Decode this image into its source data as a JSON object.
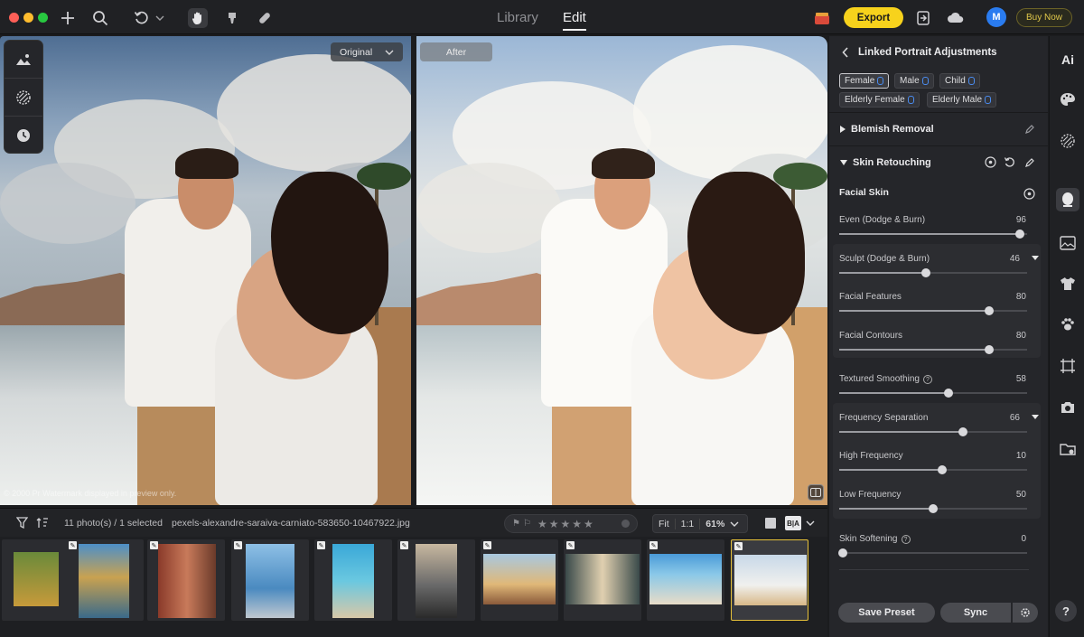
{
  "titlebar": {
    "tabs": [
      {
        "label": "Library",
        "active": false
      },
      {
        "label": "Edit",
        "active": true
      }
    ],
    "export_label": "Export",
    "avatar_initial": "M",
    "buy_label": "Buy Now"
  },
  "canvas": {
    "original_label": "Original",
    "after_label": "After",
    "watermark": "© 2000 Pr Watermark displayed in preview only."
  },
  "filmbar": {
    "count": "11 photo(s) / 1 selected",
    "filename": "pexels-alexandre-saraiva-carniato-583650-10467922.jpg",
    "fit_label": "Fit",
    "ratio_label": "1:1",
    "zoom": "61%",
    "stars": "★★★★★",
    "ba_label": "B|A"
  },
  "panel": {
    "title": "Linked Portrait Adjustments",
    "chips": [
      {
        "label": "Female",
        "active": true
      },
      {
        "label": "Male",
        "active": false
      },
      {
        "label": "Child",
        "active": false
      },
      {
        "label": "Elderly Female",
        "active": false
      },
      {
        "label": "Elderly Male",
        "active": false
      }
    ],
    "blemish": "Blemish Removal",
    "skin": "Skin Retouching",
    "facial_skin": "Facial Skin",
    "sliders": [
      {
        "label": "Even (Dodge & Burn)",
        "value": "96"
      },
      {
        "label": "Sculpt (Dodge & Burn)",
        "value": "46"
      },
      {
        "label": "Facial Features",
        "value": "80"
      },
      {
        "label": "Facial Contours",
        "value": "80"
      },
      {
        "label": "Textured Smoothing",
        "value": "58"
      },
      {
        "label": "Frequency Separation",
        "value": "66"
      },
      {
        "label": "High Frequency",
        "value": "10"
      },
      {
        "label": "Low Frequency",
        "value": "50"
      },
      {
        "label": "Skin Softening",
        "value": "0"
      }
    ],
    "save_preset": "Save Preset",
    "sync": "Sync"
  },
  "iconbar": {
    "ai_label": "Ai",
    "help": "?"
  }
}
